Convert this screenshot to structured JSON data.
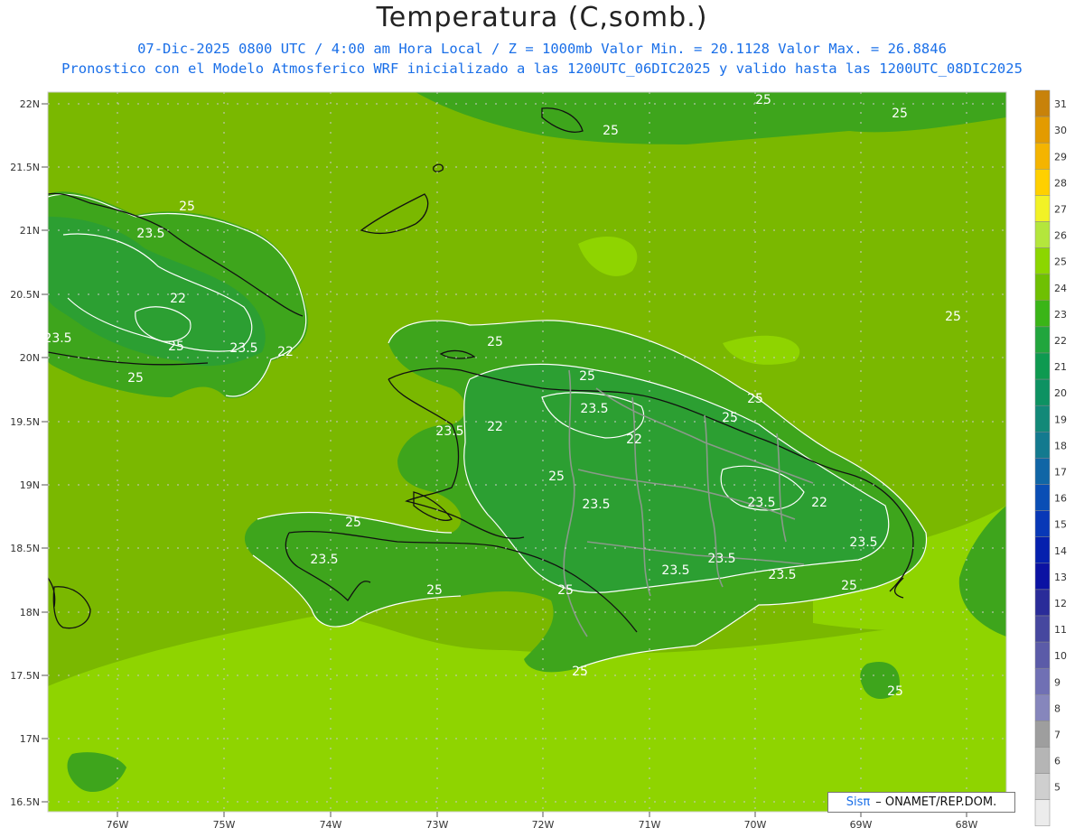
{
  "header": {
    "title": "Temperatura (C,somb.)",
    "line1": "07-Dic-2025  0800 UTC / 4:00 am Hora Local / Z = 1000mb   Valor Min. = 20.1128  Valor Max. = 26.8846",
    "line2": "Pronostico con el Modelo Atmosferico WRF inicializado a las 1200UTC_06DIC2025 y valido hasta las  1200UTC_08DIC2025"
  },
  "axes": {
    "lat_labels": [
      "22N",
      "21.5N",
      "21N",
      "20.5N",
      "20N",
      "19.5N",
      "19N",
      "18.5N",
      "18N",
      "17.5N",
      "17N",
      "16.5N"
    ],
    "lon_labels": [
      "76W",
      "75W",
      "74W",
      "73W",
      "72W",
      "71W",
      "70W",
      "69W",
      "68W"
    ]
  },
  "contour_labels": [
    "25",
    "23.5",
    "22",
    "25",
    "23.5",
    "22",
    "25",
    "23.5",
    "25",
    "25",
    "23.5",
    "22",
    "23.5",
    "25",
    "22",
    "23.5",
    "25",
    "23.5",
    "25",
    "22",
    "23.5",
    "23.5",
    "23.5",
    "23.5",
    "25",
    "25",
    "23.5",
    "25",
    "25",
    "25",
    "25",
    "25",
    "25",
    "25",
    "25"
  ],
  "legend": {
    "levels": [
      "31",
      "30",
      "29",
      "28",
      "27",
      "26",
      "25",
      "24",
      "23",
      "22",
      "21",
      "20",
      "19",
      "18",
      "17",
      "16",
      "15",
      "14",
      "13",
      "12",
      "11",
      "10",
      "9",
      "8",
      "7",
      "6",
      "5"
    ],
    "colors": [
      "#c8820a",
      "#e39b00",
      "#f4b400",
      "#ffd000",
      "#f2f226",
      "#b4e63c",
      "#8cd600",
      "#6fc002",
      "#3ab517",
      "#21a63d",
      "#0e9a50",
      "#0d9262",
      "#128978",
      "#137a8f",
      "#1066a6",
      "#0a4eb5",
      "#0838b7",
      "#0520ae",
      "#0b12a3",
      "#2a2c99",
      "#46479f",
      "#5b5ba8",
      "#7070b4",
      "#8686bc",
      "#9e9e9e",
      "#b5b5b5",
      "#cfcfcf",
      "#ececec"
    ]
  },
  "colors": {
    "ocean": "#7ab800",
    "ocean_light": "#8fd400",
    "land": "#3ea51c",
    "land_cool": "#1e9a46",
    "contour": "#ffffff",
    "coast": "#111111",
    "border": "#8a9a8a"
  },
  "credit": {
    "brand": "Sisπ",
    "text": "– ONAMET/REP.DOM."
  }
}
